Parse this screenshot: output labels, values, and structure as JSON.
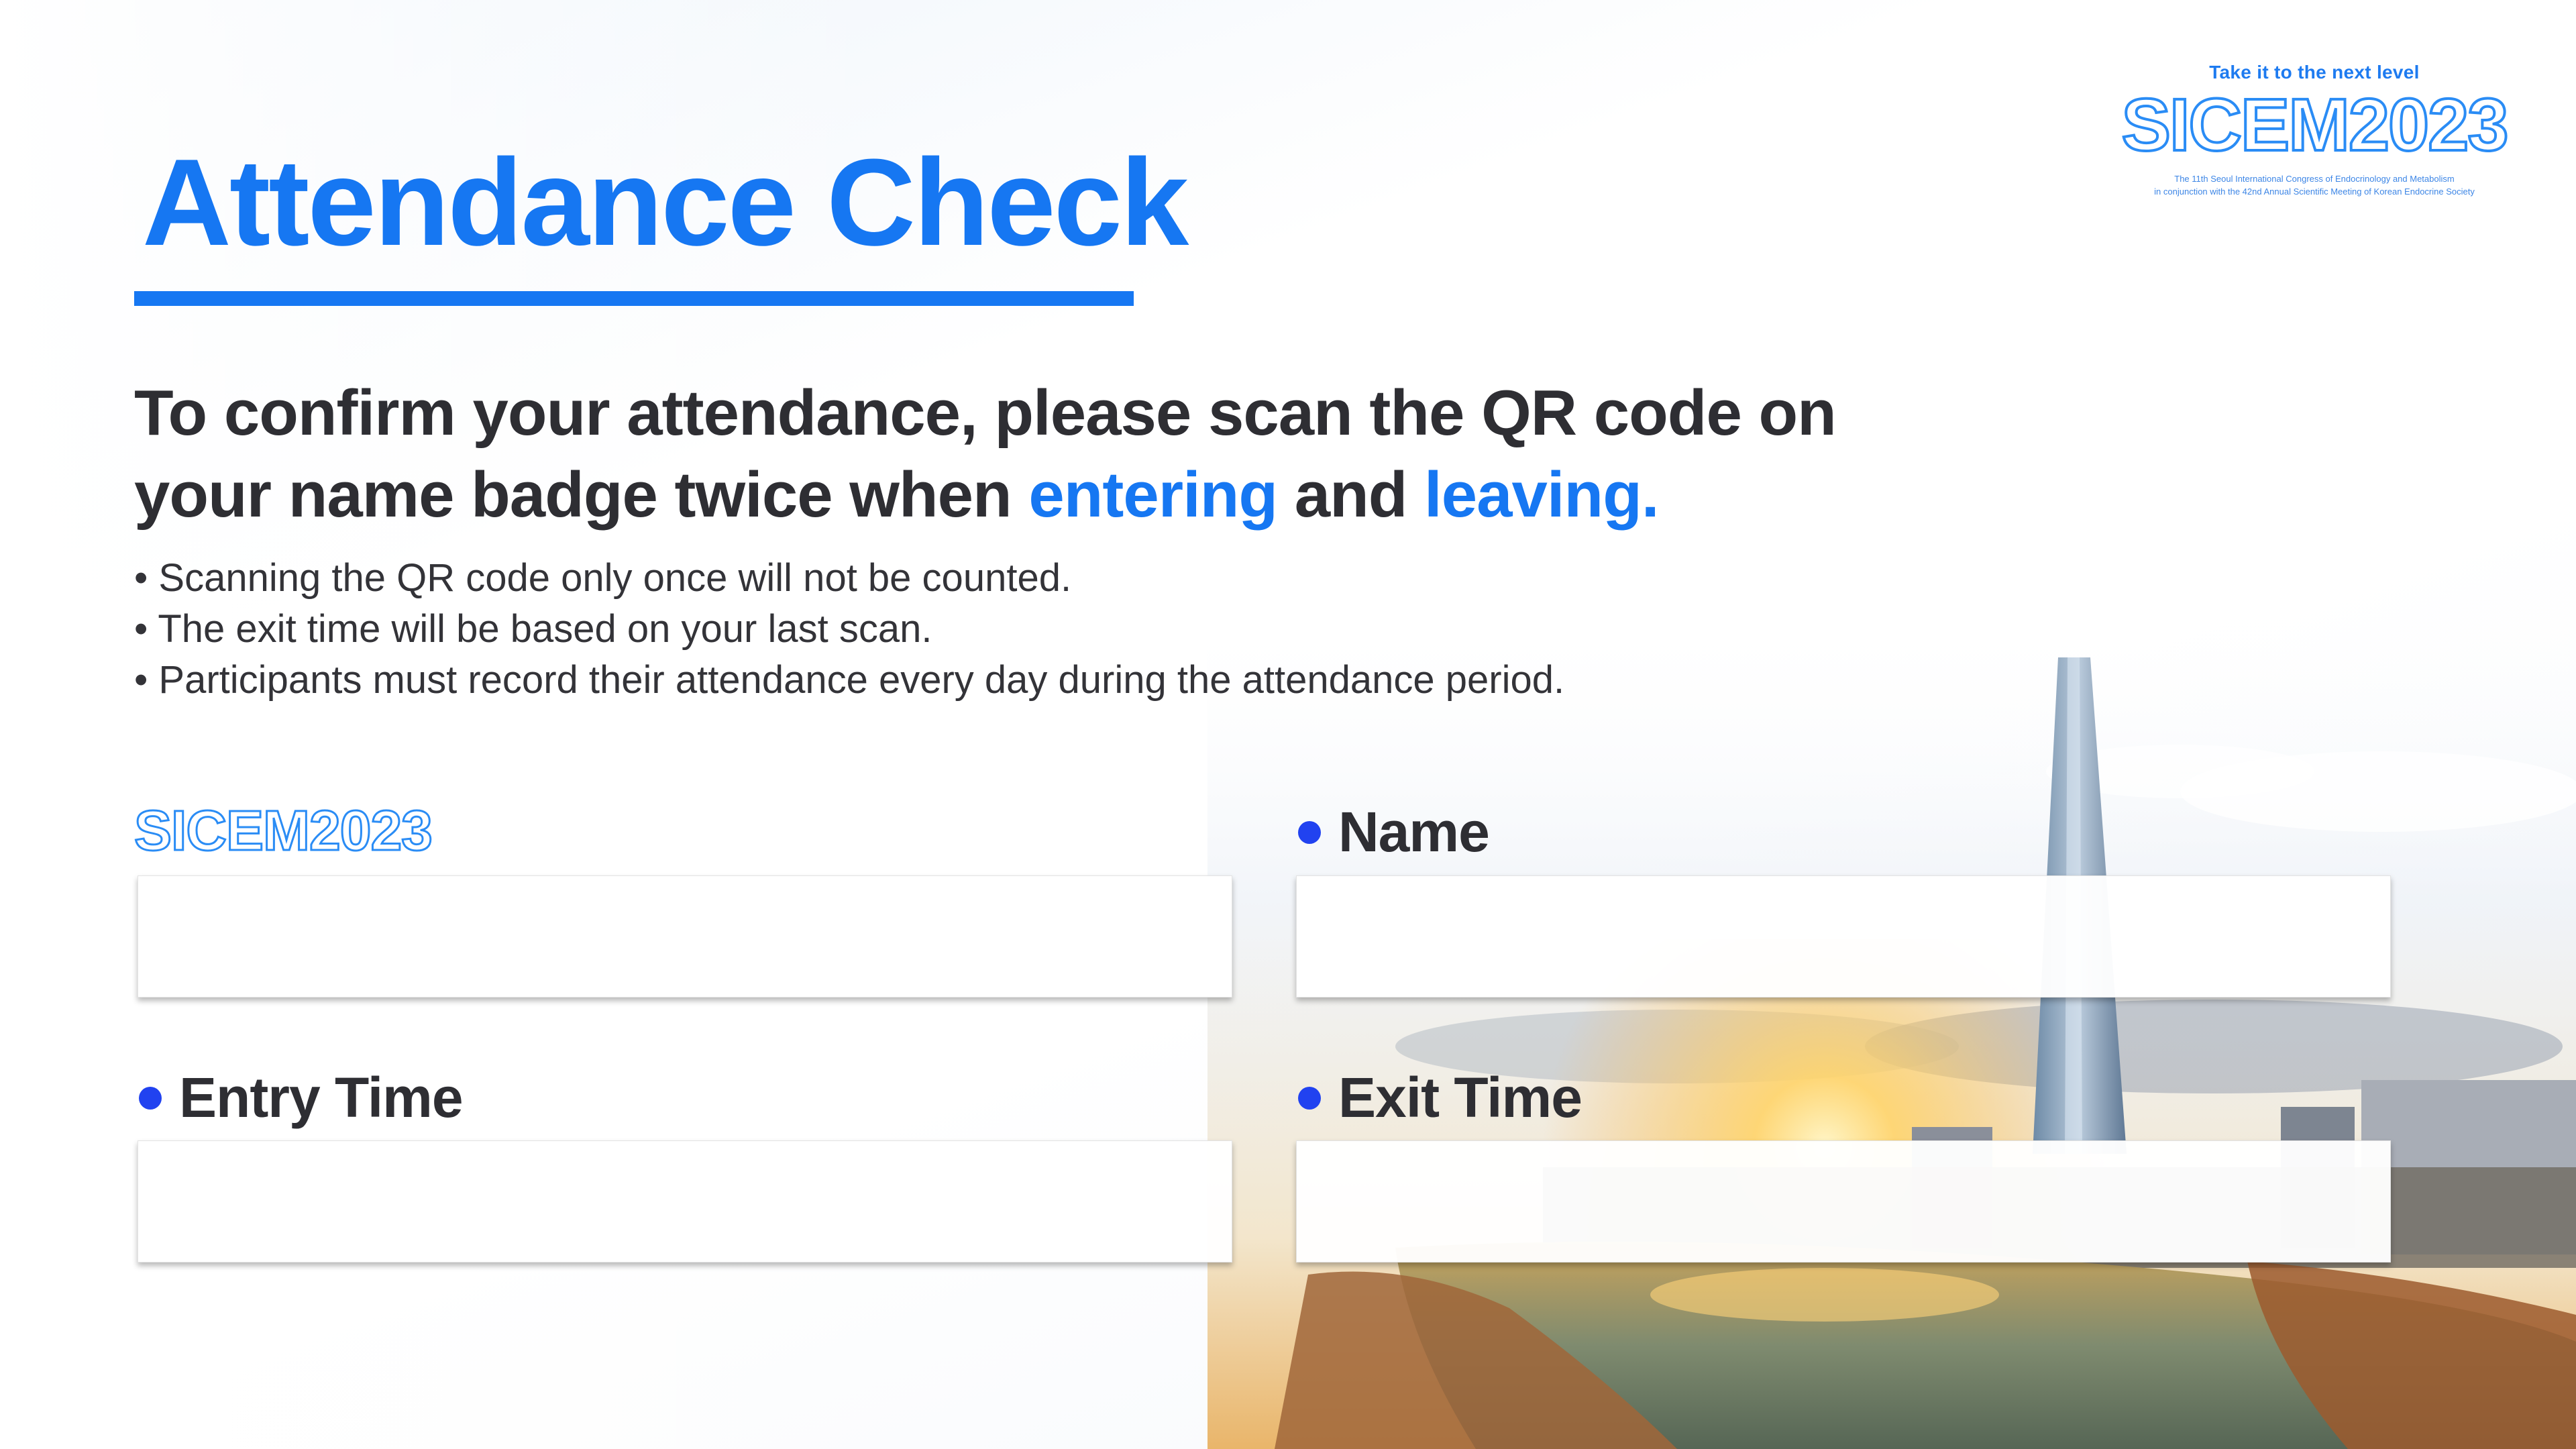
{
  "logo": {
    "tagline": "Take it to the next level",
    "name": "SICEM2023",
    "subline_1": "The 11th Seoul International Congress of Endocrinology and Metabolism",
    "subline_2": "in conjunction with the 42nd Annual Scientific Meeting of Korean Endocrine Society"
  },
  "page": {
    "title": "Attendance Check",
    "instruction_part1": "To confirm your attendance, please scan the QR code on your name badge twice when ",
    "instruction_highlight1": "entering",
    "instruction_part2": " and ",
    "instruction_highlight2": "leaving.",
    "notes": [
      "• Scanning the QR code only once will not be counted.",
      "• The exit time will be based on your last scan.",
      "• Participants must record their attendance every day during the attendance period."
    ]
  },
  "form": {
    "brand_label": "SICEM2023",
    "brand_value": "",
    "name_label": "Name",
    "name_value": "",
    "entry_label": "Entry Time",
    "entry_value": "",
    "exit_label": "Exit Time",
    "exit_value": ""
  },
  "colors": {
    "accent": "#1677f2",
    "bullet": "#2142f0",
    "text": "#2e2e33"
  }
}
